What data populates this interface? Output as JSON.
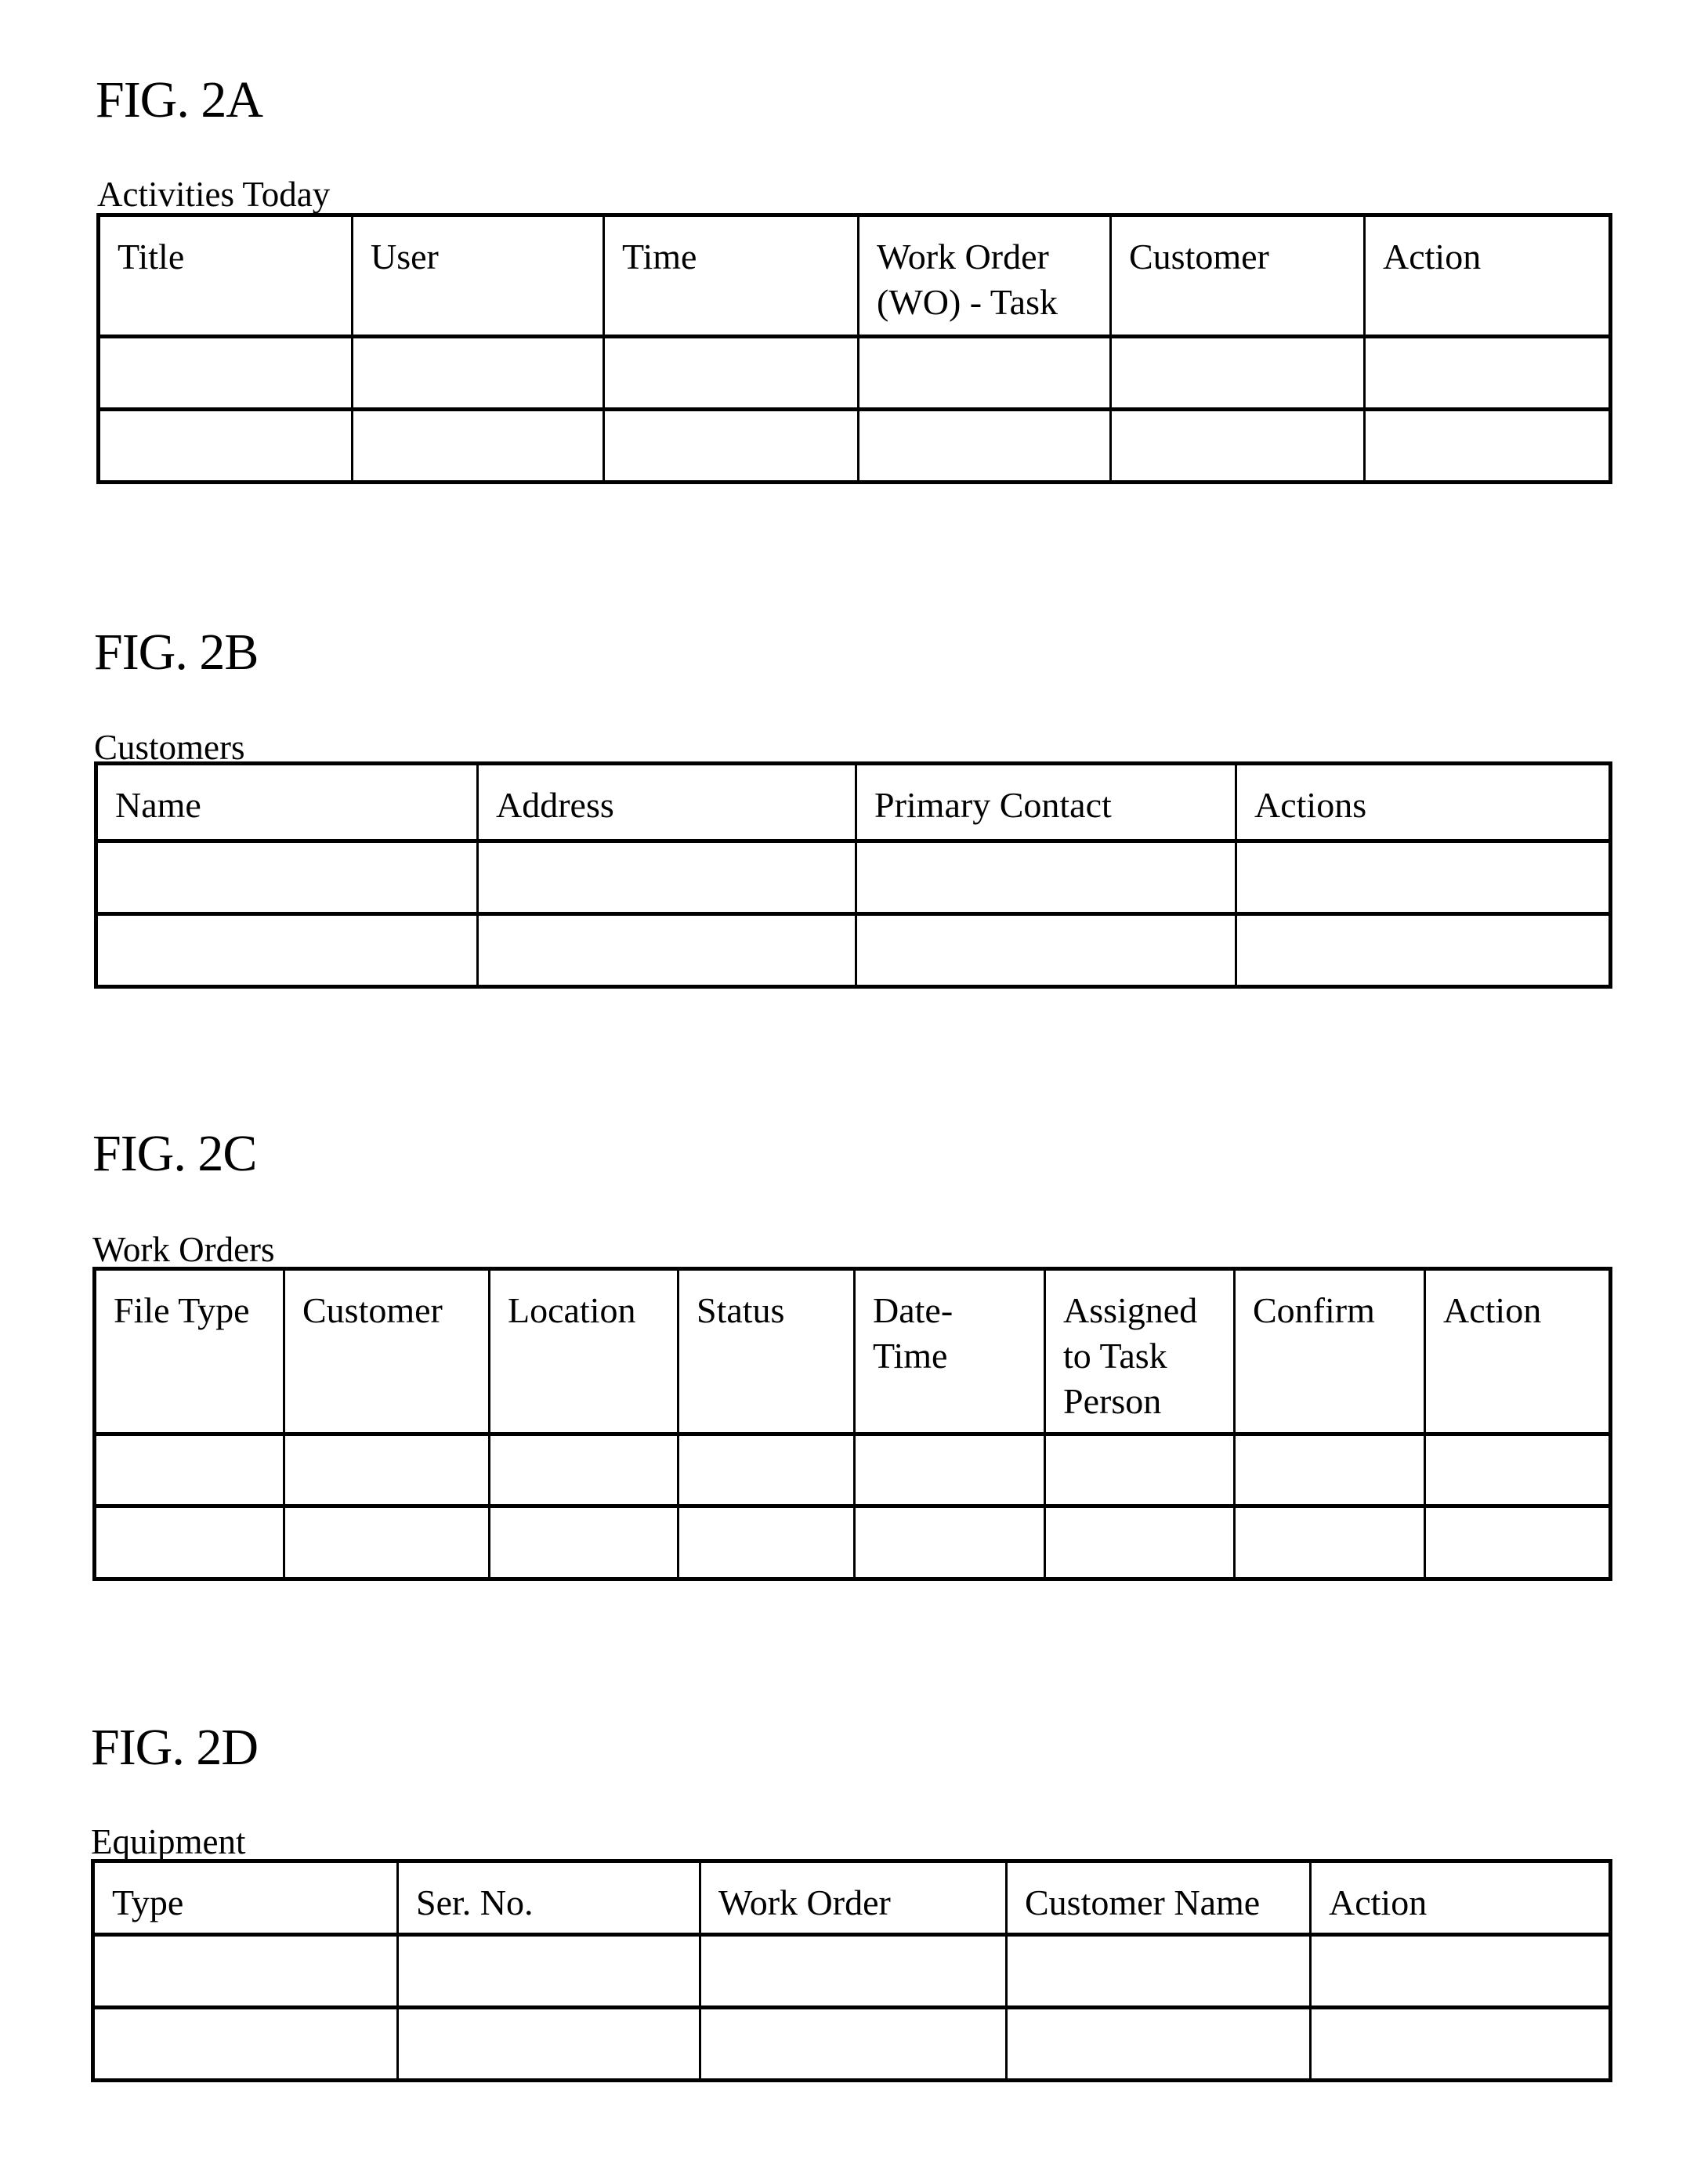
{
  "figures": {
    "fig2a": {
      "label": "FIG. 2A",
      "caption": "Activities Today",
      "columns": [
        "Title",
        "User",
        "Time",
        "Work Order (WO) - Task",
        "Customer",
        "Action"
      ],
      "rows": [
        [
          "",
          "",
          "",
          "",
          "",
          ""
        ],
        [
          "",
          "",
          "",
          "",
          "",
          ""
        ]
      ]
    },
    "fig2b": {
      "label": "FIG. 2B",
      "caption": "Customers",
      "columns": [
        "Name",
        "Address",
        "Primary Contact",
        "Actions"
      ],
      "rows": [
        [
          "",
          "",
          "",
          ""
        ],
        [
          "",
          "",
          "",
          ""
        ]
      ]
    },
    "fig2c": {
      "label": "FIG. 2C",
      "caption": "Work Orders",
      "columns": [
        "File Type",
        "Customer",
        "Location",
        "Status",
        "Date-Time",
        "Assigned to Task Person",
        "Confirm",
        "Action"
      ],
      "rows": [
        [
          "",
          "",
          "",
          "",
          "",
          "",
          "",
          ""
        ],
        [
          "",
          "",
          "",
          "",
          "",
          "",
          "",
          ""
        ]
      ]
    },
    "fig2d": {
      "label": "FIG. 2D",
      "caption": "Equipment",
      "columns": [
        "Type",
        "Ser. No.",
        "Work Order",
        "Customer Name",
        "Action"
      ],
      "rows": [
        [
          "",
          "",
          "",
          "",
          ""
        ],
        [
          "",
          "",
          "",
          "",
          ""
        ]
      ]
    }
  }
}
